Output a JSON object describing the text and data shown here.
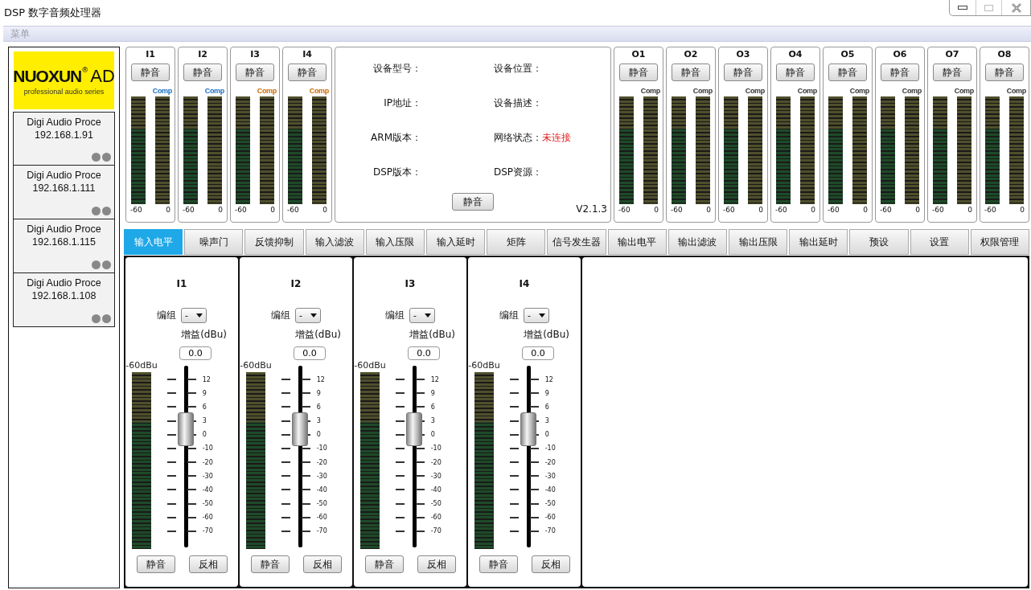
{
  "window": {
    "title": "DSP 数字音频处理器"
  },
  "menu": {
    "label": "菜单",
    "disabled": true
  },
  "logo": {
    "brand": "NUOXUN",
    "reg": "®",
    "mark": "AD",
    "tagline": "professional audio series"
  },
  "devices": [
    {
      "name": "Digi Audio Proce",
      "ip": "192.168.1.91"
    },
    {
      "name": "Digi Audio Proce",
      "ip": "192.168.1.111"
    },
    {
      "name": "Digi Audio Proce",
      "ip": "192.168.1.115"
    },
    {
      "name": "Digi Audio Proce",
      "ip": "192.168.1.108"
    }
  ],
  "inputs": [
    {
      "name": "I1",
      "mute": "静音",
      "comp": {
        "label": "Comp",
        "color": "#1a6fc0"
      },
      "scale_min": "-60",
      "scale_max": "0"
    },
    {
      "name": "I2",
      "mute": "静音",
      "comp": {
        "label": "Comp",
        "color": "#1a6fc0"
      },
      "scale_min": "-60",
      "scale_max": "0"
    },
    {
      "name": "I3",
      "mute": "静音",
      "comp": {
        "label": "Comp",
        "color": "#c86a00"
      },
      "scale_min": "-60",
      "scale_max": "0"
    },
    {
      "name": "I4",
      "mute": "静音",
      "comp": {
        "label": "Comp",
        "color": "#c86a00"
      },
      "scale_min": "-60",
      "scale_max": "0"
    }
  ],
  "info": {
    "fields": [
      {
        "label": "设备型号："
      },
      {
        "label": "设备位置："
      },
      {
        "label": "IP地址："
      },
      {
        "label": "设备描述："
      },
      {
        "label": "ARM版本："
      },
      {
        "label": "网络状态：",
        "value": "未连接"
      },
      {
        "label": "DSP版本："
      },
      {
        "label": "DSP资源："
      }
    ],
    "mute": "静音",
    "version": "V2.1.3"
  },
  "outputs": [
    {
      "name": "O1",
      "mute": "静音",
      "comp": {
        "label": "Comp",
        "color": "#333333"
      },
      "scale_min": "-60",
      "scale_max": "0"
    },
    {
      "name": "O2",
      "mute": "静音",
      "comp": {
        "label": "Comp",
        "color": "#333333"
      },
      "scale_min": "-60",
      "scale_max": "0"
    },
    {
      "name": "O3",
      "mute": "静音",
      "comp": {
        "label": "Comp",
        "color": "#333333"
      },
      "scale_min": "-60",
      "scale_max": "0"
    },
    {
      "name": "O4",
      "mute": "静音",
      "comp": {
        "label": "Comp",
        "color": "#333333"
      },
      "scale_min": "-60",
      "scale_max": "0"
    },
    {
      "name": "O5",
      "mute": "静音",
      "comp": {
        "label": "Comp",
        "color": "#333333"
      },
      "scale_min": "-60",
      "scale_max": "0"
    },
    {
      "name": "O6",
      "mute": "静音",
      "comp": {
        "label": "Comp",
        "color": "#333333"
      },
      "scale_min": "-60",
      "scale_max": "0"
    },
    {
      "name": "O7",
      "mute": "静音",
      "comp": {
        "label": "Comp",
        "color": "#333333"
      },
      "scale_min": "-60",
      "scale_max": "0"
    },
    {
      "name": "O8",
      "mute": "静音",
      "comp": {
        "label": "Comp",
        "color": "#333333"
      },
      "scale_min": "-60",
      "scale_max": "0"
    }
  ],
  "tabs": [
    {
      "label": "输入电平",
      "selected": true
    },
    {
      "label": "噪声门",
      "selected": false
    },
    {
      "label": "反馈抑制",
      "selected": false
    },
    {
      "label": "输入滤波",
      "selected": false
    },
    {
      "label": "输入压限",
      "selected": false
    },
    {
      "label": "输入延时",
      "selected": false
    },
    {
      "label": "矩阵",
      "selected": false
    },
    {
      "label": "信号发生器",
      "selected": false
    },
    {
      "label": "输出电平",
      "selected": false
    },
    {
      "label": "输出滤波",
      "selected": false
    },
    {
      "label": "输出压限",
      "selected": false
    },
    {
      "label": "输出延时",
      "selected": false
    },
    {
      "label": "预设",
      "selected": false
    },
    {
      "label": "设置",
      "selected": false
    },
    {
      "label": "权限管理",
      "selected": false
    }
  ],
  "strips": [
    {
      "name": "I1",
      "group_label": "编组",
      "group_value": "-",
      "gain_label": "增益(dBu)",
      "gain_value": "0.0",
      "meter_label": "-60dBu",
      "fader": {
        "level": 0.65
      },
      "ticks": [
        "12",
        "9",
        "6",
        "3",
        "0",
        "-10",
        "-20",
        "-30",
        "-40",
        "-50",
        "-60",
        "-70"
      ],
      "mute": "静音",
      "invert": "反相"
    },
    {
      "name": "I2",
      "group_label": "编组",
      "group_value": "-",
      "gain_label": "增益(dBu)",
      "gain_value": "0.0",
      "meter_label": "-60dBu",
      "fader": {
        "level": 0.65
      },
      "ticks": [
        "12",
        "9",
        "6",
        "3",
        "0",
        "-10",
        "-20",
        "-30",
        "-40",
        "-50",
        "-60",
        "-70"
      ],
      "mute": "静音",
      "invert": "反相"
    },
    {
      "name": "I3",
      "group_label": "编组",
      "group_value": "-",
      "gain_label": "增益(dBu)",
      "gain_value": "0.0",
      "meter_label": "-60dBu",
      "fader": {
        "level": 0.65
      },
      "ticks": [
        "12",
        "9",
        "6",
        "3",
        "0",
        "-10",
        "-20",
        "-30",
        "-40",
        "-50",
        "-60",
        "-70"
      ],
      "mute": "静音",
      "invert": "反相"
    },
    {
      "name": "I4",
      "group_label": "编组",
      "group_value": "-",
      "gain_label": "增益(dBu)",
      "gain_value": "0.0",
      "meter_label": "-60dBu",
      "fader": {
        "level": 0.65
      },
      "ticks": [
        "12",
        "9",
        "6",
        "3",
        "0",
        "-10",
        "-20",
        "-30",
        "-40",
        "-50",
        "-60",
        "-70"
      ],
      "mute": "静音",
      "invert": "反相"
    }
  ]
}
